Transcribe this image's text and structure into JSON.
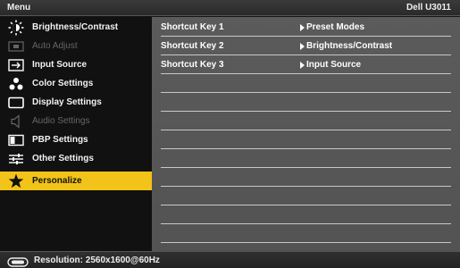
{
  "header": {
    "menu_title": "Menu",
    "model": "Dell U3011"
  },
  "sidebar": {
    "items": [
      {
        "label": "Brightness/Contrast",
        "icon": "sun-icon",
        "state": "normal"
      },
      {
        "label": "Auto Adjust",
        "icon": "auto-adjust-icon",
        "state": "disabled"
      },
      {
        "label": "Input Source",
        "icon": "input-source-icon",
        "state": "normal"
      },
      {
        "label": "Color Settings",
        "icon": "color-settings-icon",
        "state": "normal"
      },
      {
        "label": "Display Settings",
        "icon": "display-icon",
        "state": "normal"
      },
      {
        "label": "Audio Settings",
        "icon": "speaker-icon",
        "state": "disabled"
      },
      {
        "label": "PBP Settings",
        "icon": "pbp-icon",
        "state": "normal"
      },
      {
        "label": "Other Settings",
        "icon": "sliders-icon",
        "state": "normal"
      },
      {
        "label": "Personalize",
        "icon": "star-icon",
        "state": "selected"
      }
    ]
  },
  "content": {
    "rows": [
      {
        "key": "Shortcut Key 1",
        "value": "Preset Modes"
      },
      {
        "key": "Shortcut Key 2",
        "value": "Brightness/Contrast"
      },
      {
        "key": "Shortcut Key 3",
        "value": "Input Source"
      }
    ],
    "empty_rows": 9
  },
  "status": {
    "resolution": "Resolution: 2560x1600@60Hz",
    "icon": "monitor-icon"
  },
  "colors": {
    "selected": "#f2c318",
    "panel": "#585858",
    "sidebar": "#111111"
  }
}
